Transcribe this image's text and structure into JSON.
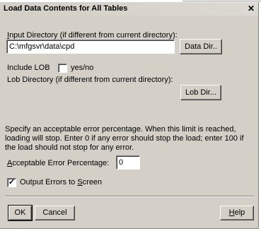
{
  "window": {
    "title": "Load Data Contents for All Tables",
    "close_glyph": "✕"
  },
  "input_directory": {
    "label": "Input Directory (if different from current directory):",
    "label_underline": "I",
    "label_rest": "nput Directory (if different from current directory):",
    "value": "C:\\mfgsvr\\data\\cpd",
    "button_label": "Data Dir.."
  },
  "include_lob": {
    "label": "Include LOB",
    "checked": false,
    "suffix": "yes/no"
  },
  "lob_directory": {
    "label": "Lob Directory (if different from current directory):",
    "button_label": "Lob Dir..."
  },
  "description": "Specify an acceptable error percentage.  When this limit is reached, loading will stop.  Enter 0 if any error should stop the load; enter 100 if the load should not stop for any error.",
  "error_percentage": {
    "label_underline": "A",
    "label_rest": "cceptable Error Percentage:",
    "value": "0"
  },
  "output_errors": {
    "checked": true,
    "check_glyph": "✓",
    "label_pre": "Output Errors to ",
    "label_underline": "S",
    "label_post": "creen"
  },
  "buttons": {
    "ok": "OK",
    "cancel": "Cancel",
    "help_underline": "H",
    "help_rest": "elp"
  }
}
